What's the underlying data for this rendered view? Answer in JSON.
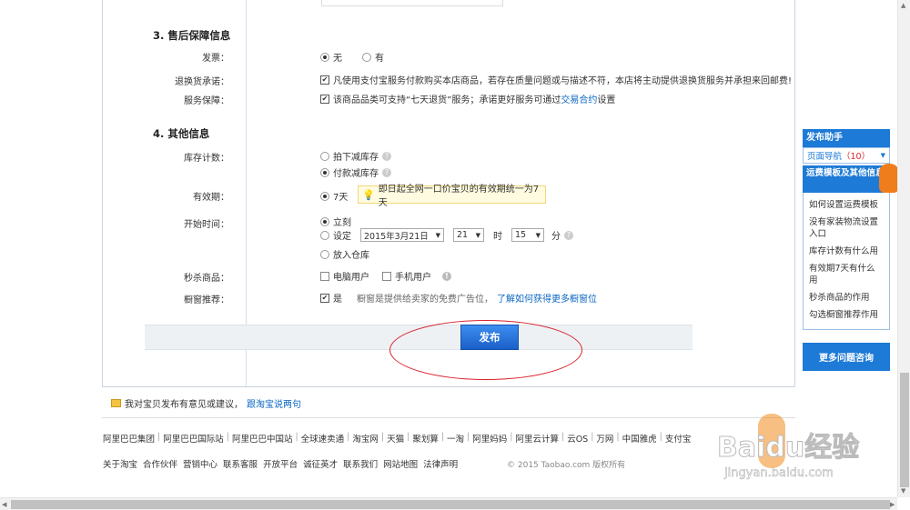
{
  "after_sales": {
    "title": "3. 售后保障信息",
    "invoice_label": "发票：",
    "invoice_none": "无",
    "invoice_yes": "有",
    "return_label": "退换货承诺：",
    "return_text": "凡使用支付宝服务付款购买本店商品，若存在质量问题或与描述不符，本店将主动提供退换货服务并承担来回邮费!",
    "service_label": "服务保障：",
    "service_text_prefix": "该商品品类可支持“七天退货”服务；承诺更好服务可通过",
    "service_link": "交易合约",
    "service_text_suffix": "设置"
  },
  "other_info": {
    "title": "4. 其他信息",
    "stock_label": "库存计数：",
    "stock_option_1": "拍下减库存",
    "stock_option_2": "付款减库存",
    "validity_label": "有效期：",
    "validity_value": "7天",
    "validity_tip": "即日起全网一口价宝贝的有效期统一为7天",
    "start_label": "开始时间：",
    "start_now": "立刻",
    "start_set": "设定",
    "date_value": "2015年3月21日",
    "hour_value": "21",
    "hour_unit": "时",
    "minute_value": "15",
    "minute_unit": "分",
    "start_warehouse": "放入仓库",
    "flash_label": "秒杀商品：",
    "flash_pc": "电脑用户",
    "flash_mobile": "手机用户",
    "window_label": "橱窗推荐：",
    "window_yes": "是",
    "window_desc": "橱窗是提供给卖家的免费广告位，",
    "window_link": "了解如何获得更多橱窗位"
  },
  "publish_label": "发布",
  "feedback": {
    "text": "我对宝贝发布有意见或建议，",
    "link": "跟淘宝说两句"
  },
  "footer_links_1": [
    "阿里巴巴集团",
    "阿里巴巴国际站",
    "阿里巴巴中国站",
    "全球速卖通",
    "淘宝网",
    "天猫",
    "聚划算",
    "一淘",
    "阿里妈妈",
    "阿里云计算",
    "云OS",
    "万网",
    "中国雅虎",
    "支付宝"
  ],
  "footer_links_2": [
    "关于淘宝",
    "合作伙伴",
    "营销中心",
    "联系客服",
    "开放平台",
    "诚征英才",
    "联系我们",
    "网站地图",
    "法律声明"
  ],
  "copyright": "© 2015 Taobao.com 版权所有",
  "helper": {
    "title": "发布助手",
    "nav_label": "页面导航",
    "nav_count": "（10）",
    "section_title": "运费模板及其他信息",
    "items": [
      "如何设置运费模板",
      "没有家装物流设置入口",
      "库存计数有什么用",
      "有效期7天有什么用",
      "秒杀商品的作用",
      "勾选橱窗推荐作用"
    ],
    "more": "更多问题咨询"
  },
  "watermark": {
    "brand": "Baidu经验",
    "url": "jingyan.baidu.com"
  },
  "colors": {
    "accent": "#1d7ad6",
    "link": "#0b66c3",
    "highlight_ring": "#d9232d"
  }
}
